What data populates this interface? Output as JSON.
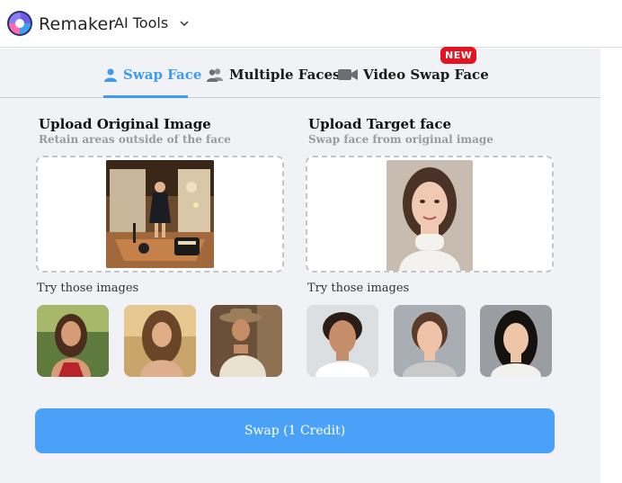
{
  "header": {
    "brand": "Remaker",
    "menu_label": "AI Tools",
    "logo_icon": "remaker-swirl-logo",
    "chevron_icon": "chevron-down-icon"
  },
  "tabs": [
    {
      "label": "Swap Face",
      "icon": "person-icon",
      "active": true
    },
    {
      "label": "Multiple Faces",
      "icon": "people-icon",
      "active": false
    },
    {
      "label": "Video Swap Face",
      "icon": "video-camera-icon",
      "active": false,
      "badge": "NEW"
    }
  ],
  "original": {
    "title": "Upload Original Image",
    "subtitle": "Retain areas outside of the face",
    "try_label": "Try those images"
  },
  "target": {
    "title": "Upload Target face",
    "subtitle": "Swap face from original image",
    "try_label": "Try those images"
  },
  "swap_button": "Swap (1 Credit)",
  "colors": {
    "accent": "#3f9bf2",
    "button": "#4aa2f8",
    "badge": "#e4131f",
    "panel_bg": "#f1f2f6"
  }
}
